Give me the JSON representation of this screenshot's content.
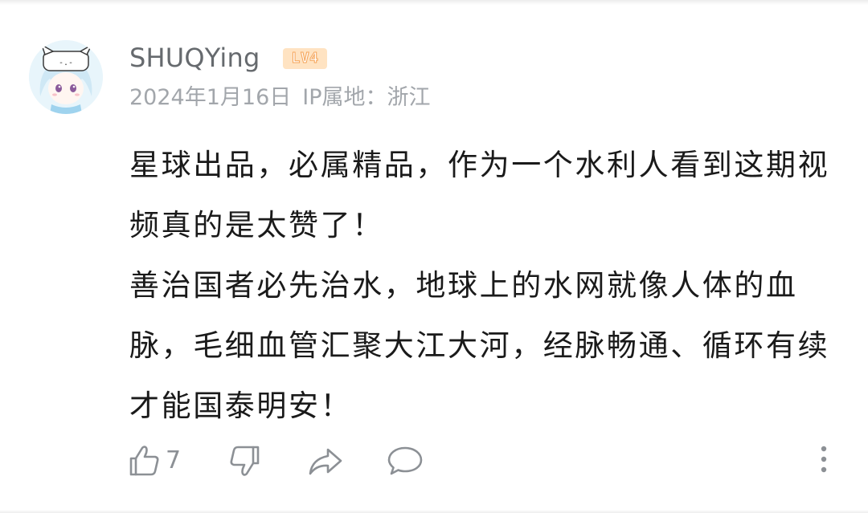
{
  "comment": {
    "user": {
      "name": "SHUQYing",
      "level_badge": "LV4"
    },
    "meta": {
      "date": "2024年1月16日",
      "ip_location": "IP属地：浙江"
    },
    "paragraphs": [
      "星球出品，必属精品，作为一个水利人看到这期视频真的是太赞了！",
      "善治国者必先治水，地球上的水网就像人体的血脉，毛细血管汇聚大江大河，经脉畅通、循环有续才能国泰明安！"
    ],
    "actions": {
      "like_count": "7",
      "icons": [
        "thumbs-up-icon",
        "thumbs-down-icon",
        "share-icon",
        "reply-icon",
        "more-icon"
      ]
    },
    "colors": {
      "text_primary": "#1a1a1a",
      "text_secondary": "#666a6e",
      "text_meta": "#a2a6ab",
      "icon": "#8c9095",
      "badge_bg": "#ffe3c2",
      "badge_stroke": "#f5a356"
    }
  }
}
